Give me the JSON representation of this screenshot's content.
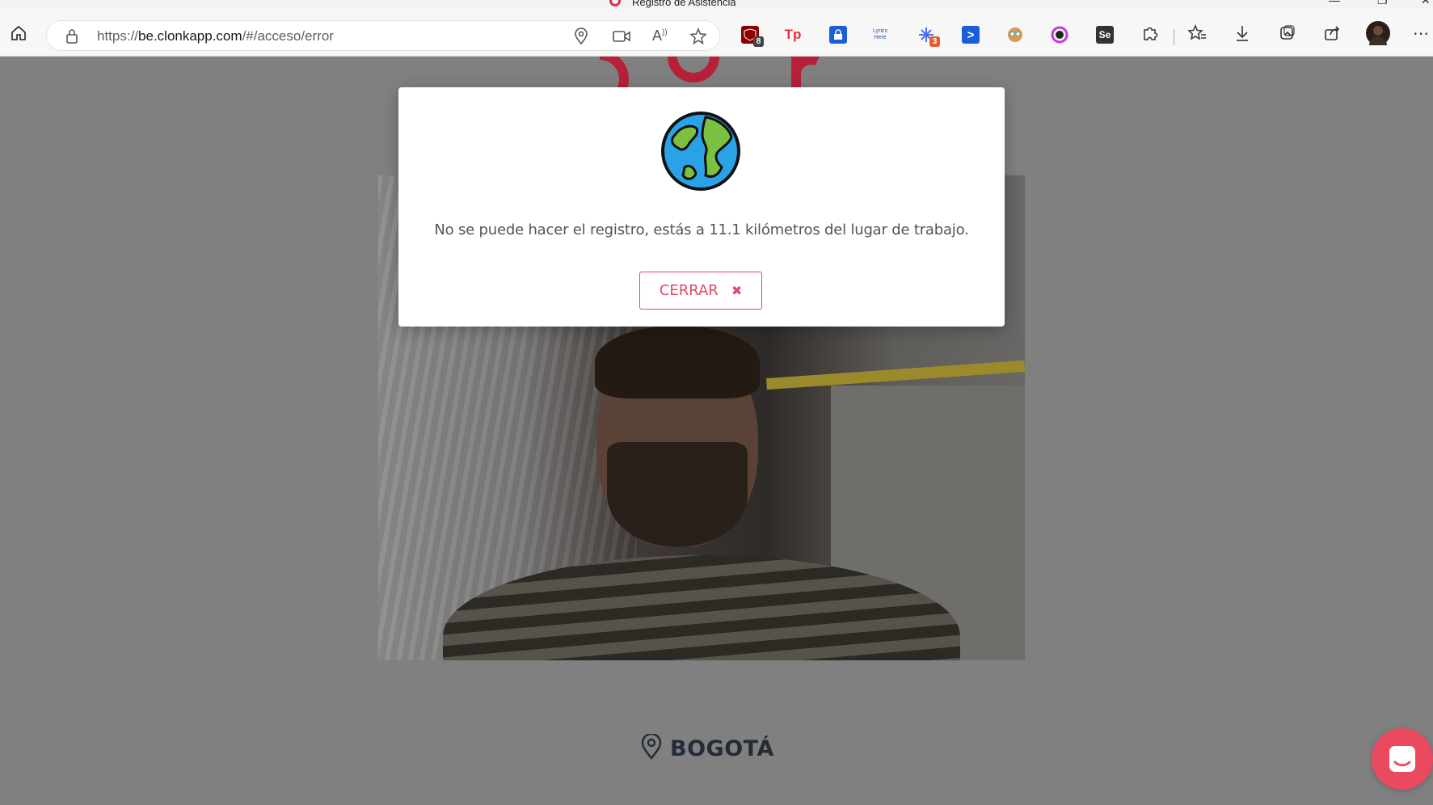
{
  "browser": {
    "tab_title": "Registro de Asistencia",
    "url_scheme": "https://",
    "url_host": "be.clonkapp.com",
    "url_path": "/#/acceso/error",
    "extensions": [
      {
        "name": "ublock-icon",
        "badge": "8",
        "color": "#8b0000"
      },
      {
        "name": "tp-icon",
        "label": "Tp",
        "color": "#ffffff"
      },
      {
        "name": "lock-extension-icon",
        "color": "#1a5fd8"
      },
      {
        "name": "lyrics-here-icon",
        "label": "Lyrics Here",
        "color": "#ffffff"
      },
      {
        "name": "spark-extension-icon",
        "badge": "3",
        "color": "#ffffff"
      },
      {
        "name": "arrow-extension-icon",
        "color": "#1a5fd8"
      },
      {
        "name": "face-extension-icon",
        "color": "#ffffff"
      },
      {
        "name": "color-ring-icon",
        "color": "#ffffff"
      },
      {
        "name": "se-extension-icon",
        "label": "Se",
        "color": "#333333"
      }
    ]
  },
  "modal": {
    "message": "No se puede hacer el registro, estás a 11.1 kilómetros del lugar de trabajo.",
    "close_label": "CERRAR",
    "accent": "#e0496a"
  },
  "location": {
    "city": "BOGOTÁ"
  }
}
